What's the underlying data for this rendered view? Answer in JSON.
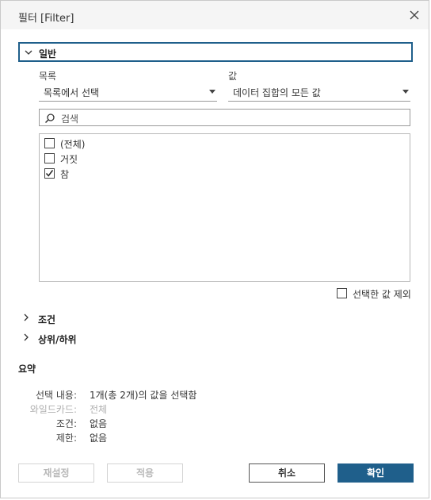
{
  "dialog": {
    "title": "필터 [Filter]"
  },
  "general": {
    "label": "일반",
    "list_label": "목록",
    "list_mode": "목록에서 선택",
    "value_label": "값",
    "value_mode": "데이터 집합의 모든 값",
    "search_placeholder": "검색",
    "items": [
      {
        "label": "(전체)",
        "checked": false
      },
      {
        "label": "거짓",
        "checked": false
      },
      {
        "label": "참",
        "checked": true
      }
    ],
    "exclude_label": "선택한 값 제외",
    "exclude_checked": false
  },
  "sections": {
    "condition": "조건",
    "top_bottom": "상위/하위"
  },
  "summary": {
    "title": "요약",
    "selection_key": "선택 내용:",
    "selection_value": "1개(총 2개)의 값을 선택함",
    "wildcard_key": "와일드카드:",
    "wildcard_value": "전체",
    "condition_key": "조건:",
    "condition_value": "없음",
    "limit_key": "제한:",
    "limit_value": "없음"
  },
  "buttons": {
    "reset": "재설정",
    "apply": "적용",
    "cancel": "취소",
    "ok": "확인"
  },
  "colors": {
    "accent": "#1f5f8b",
    "disabled_text": "#b8b8b8"
  }
}
